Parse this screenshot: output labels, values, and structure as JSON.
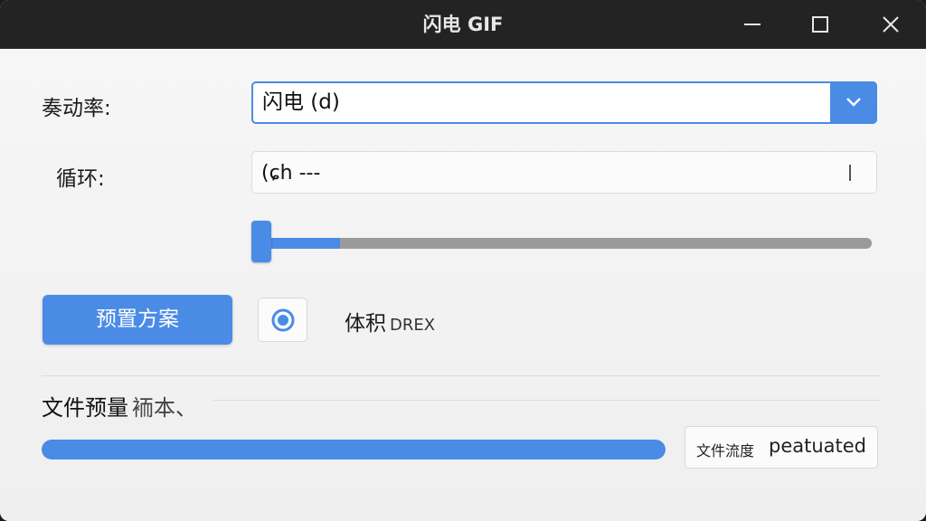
{
  "window": {
    "title": "闪电 GIF",
    "controls": [
      "minimize-icon",
      "maximize-icon",
      "close-icon"
    ]
  },
  "form": {
    "frame_rate_label": "奏动率:",
    "frame_rate_value": "闪电 (d)",
    "loop_label": "循环:",
    "loop_value": "(ɕh ---",
    "slider_level": 0.13
  },
  "actions": {
    "preset_button": "预置方案",
    "radio_selected": true,
    "radio_label": "体积",
    "radio_tag": "DREX"
  },
  "output": {
    "section_title": "文件预量",
    "section_subtitle": "袻本、",
    "progress": 1.0,
    "status_label": "文件流度",
    "status_value": "peatuated"
  },
  "colors": {
    "accent": "#4a8be6",
    "titlebar": "#232323",
    "background": "#f2f2f2"
  }
}
